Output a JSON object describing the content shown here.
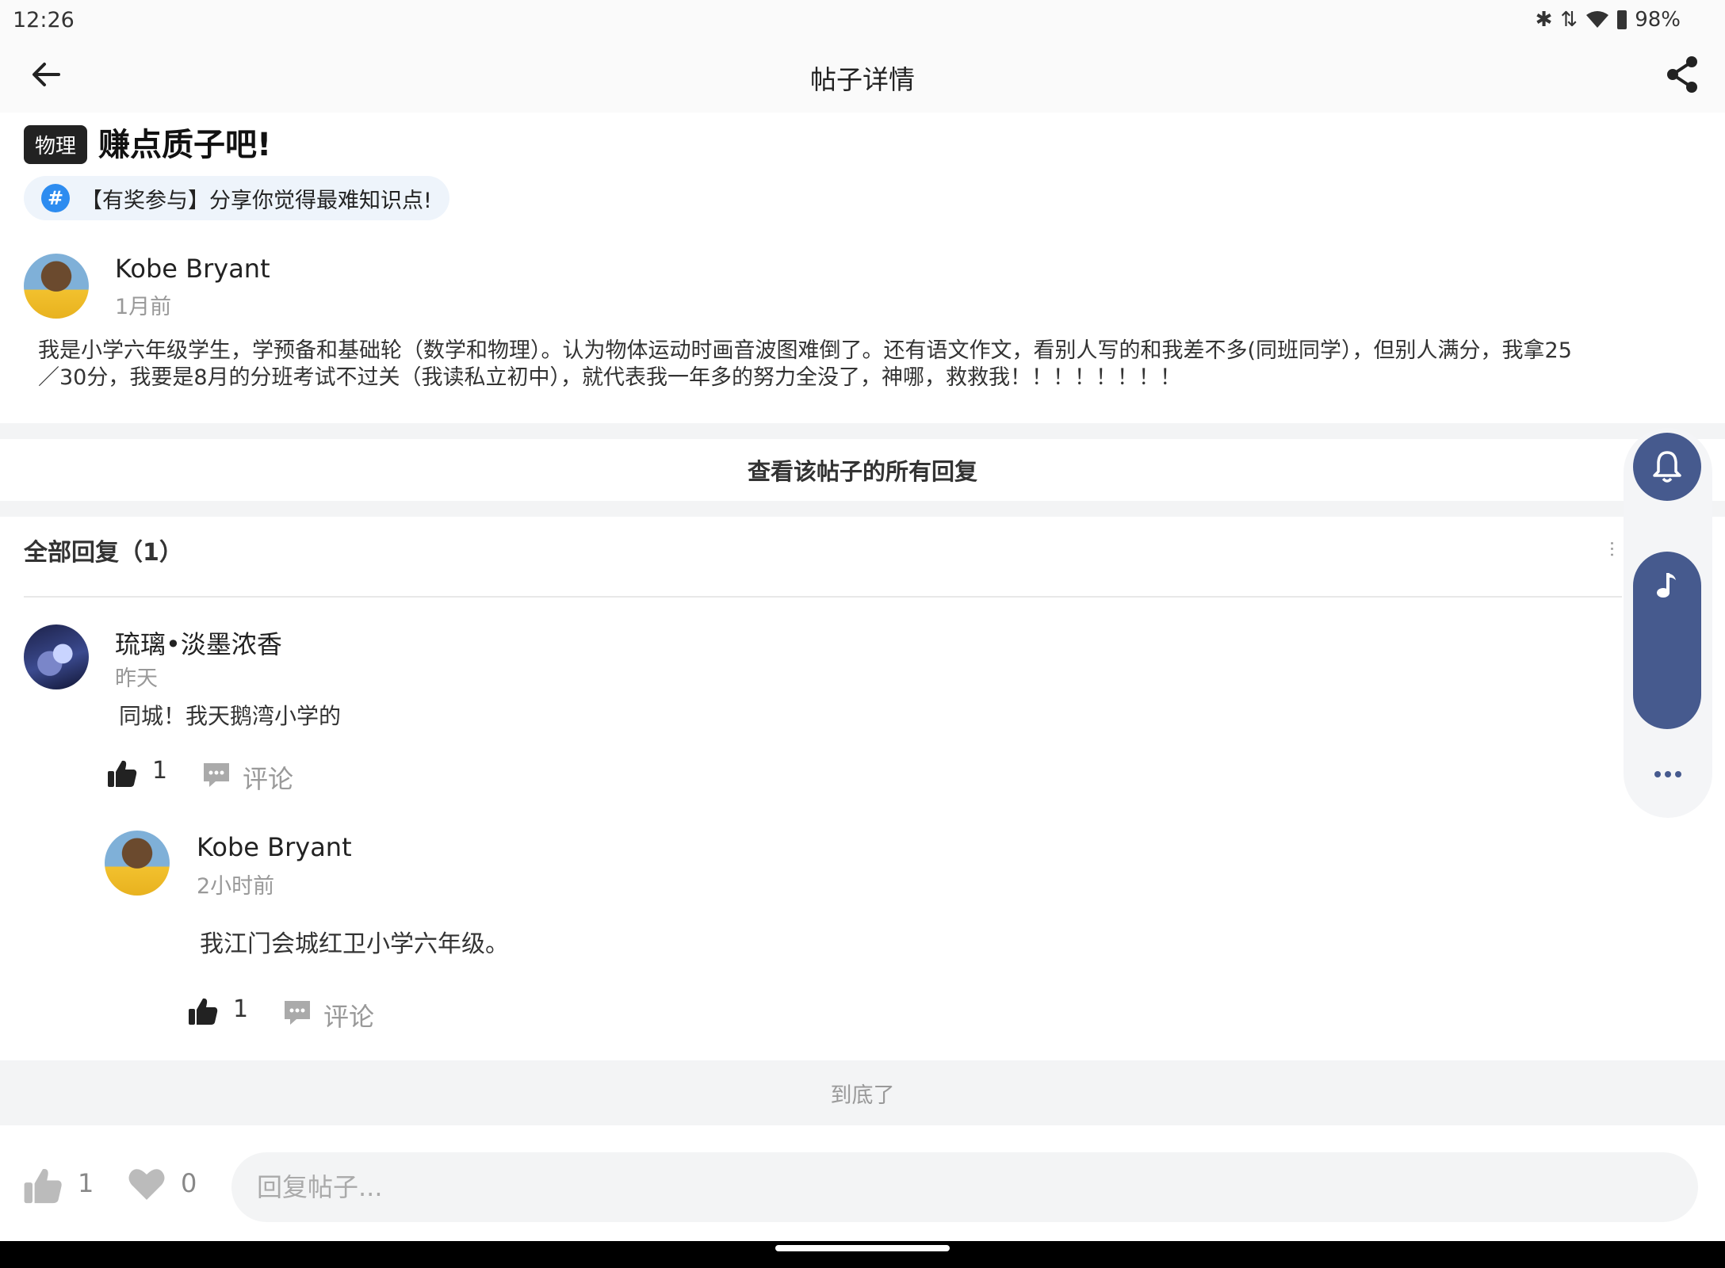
{
  "status_bar": {
    "time": "12:26",
    "battery": "98%"
  },
  "header": {
    "title": "帖子详情"
  },
  "post": {
    "tag": "物理",
    "title": "赚点质子吧!",
    "topic": "【有奖参与】分享你觉得最难知识点!",
    "author": "Kobe Bryant",
    "time": "1月前",
    "body_line1": "我是小学六年级学生，学预备和基础轮（数学和物理）。认为物体运动时画音波图难倒了。还有语文作文，看别人写的和我差不多(同班同学），但别人满分，我拿25",
    "body_line2": "／30分，我要是8月的分班考试不过关（我读私立初中），就代表我一年多的努力全没了，神哪，救救我！！！！！！！！"
  },
  "view_all": "查看该帖子的所有回复",
  "replies_header": "全部回复（1）",
  "replies": [
    {
      "author": "琉璃•淡墨浓香",
      "time": "昨天",
      "text": "同城！我天鹅湾小学的",
      "likes": "1",
      "comment_label": "评论",
      "sub_reply": {
        "author": "Kobe Bryant",
        "time": "2小时前",
        "text": "我江门会城红卫小学六年级。",
        "likes": "1",
        "comment_label": "评论"
      }
    }
  ],
  "end_text": "到底了",
  "bottom_bar": {
    "likes": "1",
    "favorites": "0",
    "reply_placeholder": "回复帖子..."
  },
  "colors": {
    "accent": "#465a8e",
    "topic_blue": "#2d8cf0"
  },
  "icons": [
    "back-arrow-icon",
    "share-icon",
    "hashtag-icon",
    "thumbs-up-icon",
    "comment-icon",
    "heart-icon",
    "bell-icon",
    "music-note-icon",
    "more-dots-icon"
  ]
}
